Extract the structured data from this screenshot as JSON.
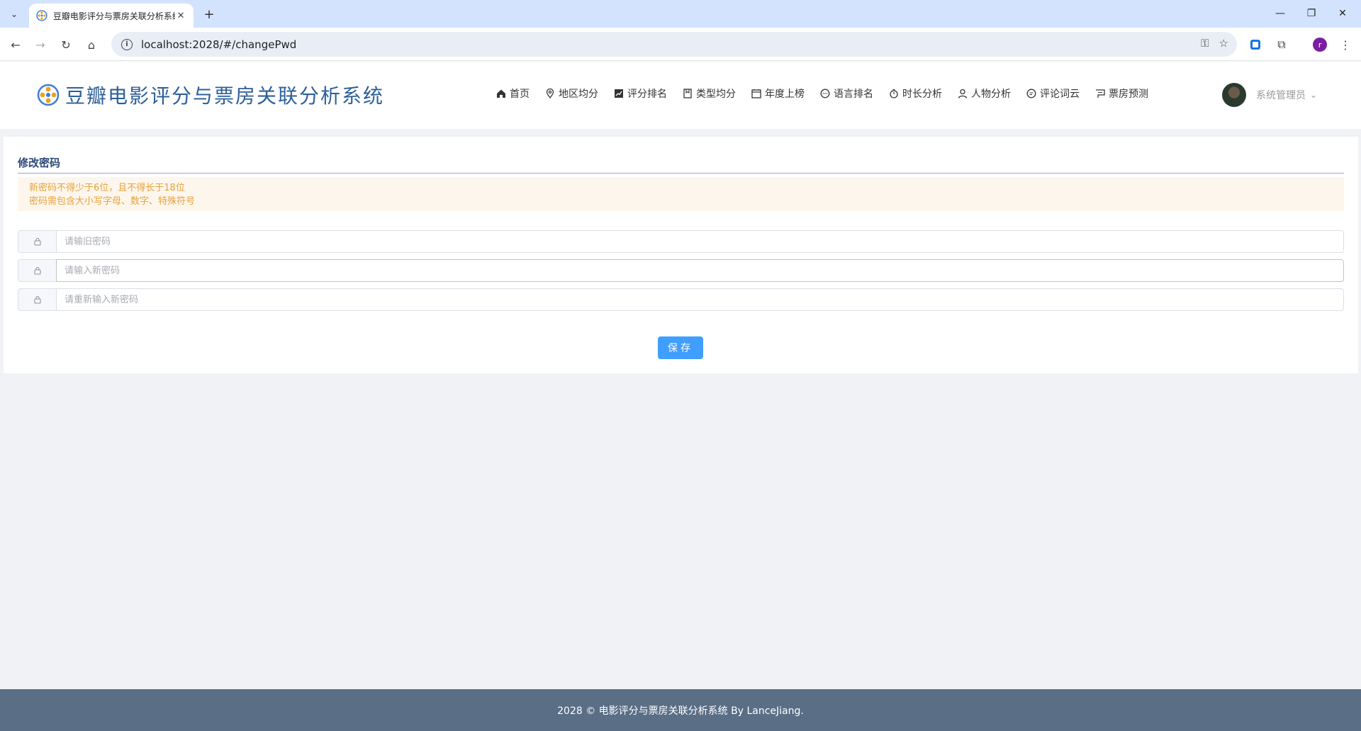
{
  "browser": {
    "tab_title": "豆瓣电影评分与票房关联分析系统",
    "url": "localhost:2028/#/changePwd",
    "profile_initial": "r"
  },
  "app": {
    "logo_text": "豆瓣电影评分与票房关联分析系统",
    "nav": [
      {
        "label": "首页",
        "icon": "home-icon"
      },
      {
        "label": "地区均分",
        "icon": "location-icon"
      },
      {
        "label": "评分排名",
        "icon": "chart-icon"
      },
      {
        "label": "类型均分",
        "icon": "bookmark-icon"
      },
      {
        "label": "年度上榜",
        "icon": "calendar-icon"
      },
      {
        "label": "语言排名",
        "icon": "chat-icon"
      },
      {
        "label": "时长分析",
        "icon": "stopwatch-icon"
      },
      {
        "label": "人物分析",
        "icon": "user-icon"
      },
      {
        "label": "评论词云",
        "icon": "comment-icon"
      },
      {
        "label": "票房预测",
        "icon": "cart-icon"
      }
    ],
    "user": {
      "name": "系统管理员"
    }
  },
  "form": {
    "title": "修改密码",
    "alert_line1": "新密码不得少于6位，且不得长于18位",
    "alert_line2": "密码需包含大小写字母、数字、特殊符号",
    "old_placeholder": "请输旧密码",
    "new_placeholder": "请输入新密码",
    "confirm_placeholder": "请重新输入新密码",
    "save_label": "保存"
  },
  "footer": {
    "text": "2028 © 电影评分与票房关联分析系统 By LanceJiang."
  },
  "colors": {
    "accent": "#409eff",
    "title": "#2d5f9a",
    "warning": "#e6a23c",
    "footer_bg": "#5a6e86"
  }
}
